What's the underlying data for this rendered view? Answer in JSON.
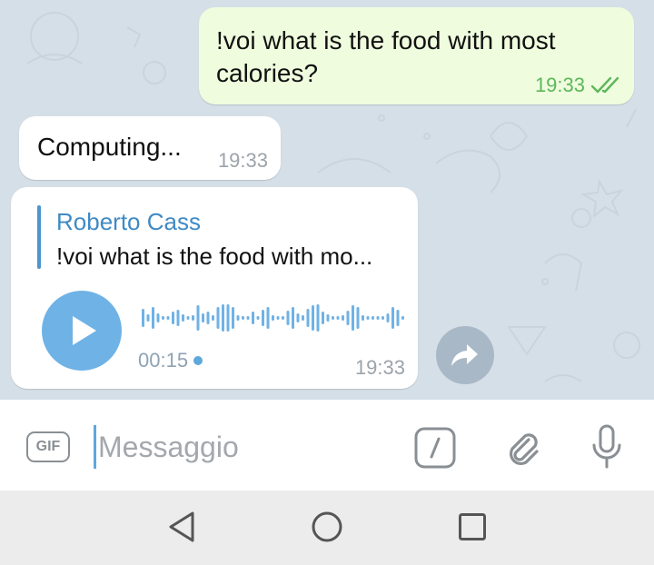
{
  "colors": {
    "chat_background": "#d5dfe7",
    "outgoing_bubble": "#effdde",
    "incoming_bubble": "#ffffff",
    "accent_blue": "#6fb2e6",
    "read_check_green": "#5db75b"
  },
  "messages": {
    "outgoing": {
      "text": "!voi what is the food with most calories?",
      "time": "19:33",
      "status_icon": "double-check-icon"
    },
    "status_reply": {
      "text": "Computing...",
      "time": "19:33"
    },
    "voice_reply": {
      "quoted_author": "Roberto Cass",
      "quoted_text": "!voi what is the food with mo...",
      "duration": "00:15",
      "time": "19:33",
      "play_icon": "play-icon"
    }
  },
  "share_button": {
    "icon": "share-arrow-icon"
  },
  "input_bar": {
    "gif_label": "GIF",
    "placeholder": "Messaggio",
    "value": "",
    "icons": [
      "bot-command-icon",
      "paperclip-icon",
      "microphone-icon"
    ]
  },
  "navigation_bar": {
    "icons": [
      "back-triangle-icon",
      "home-circle-icon",
      "recents-square-icon"
    ]
  }
}
